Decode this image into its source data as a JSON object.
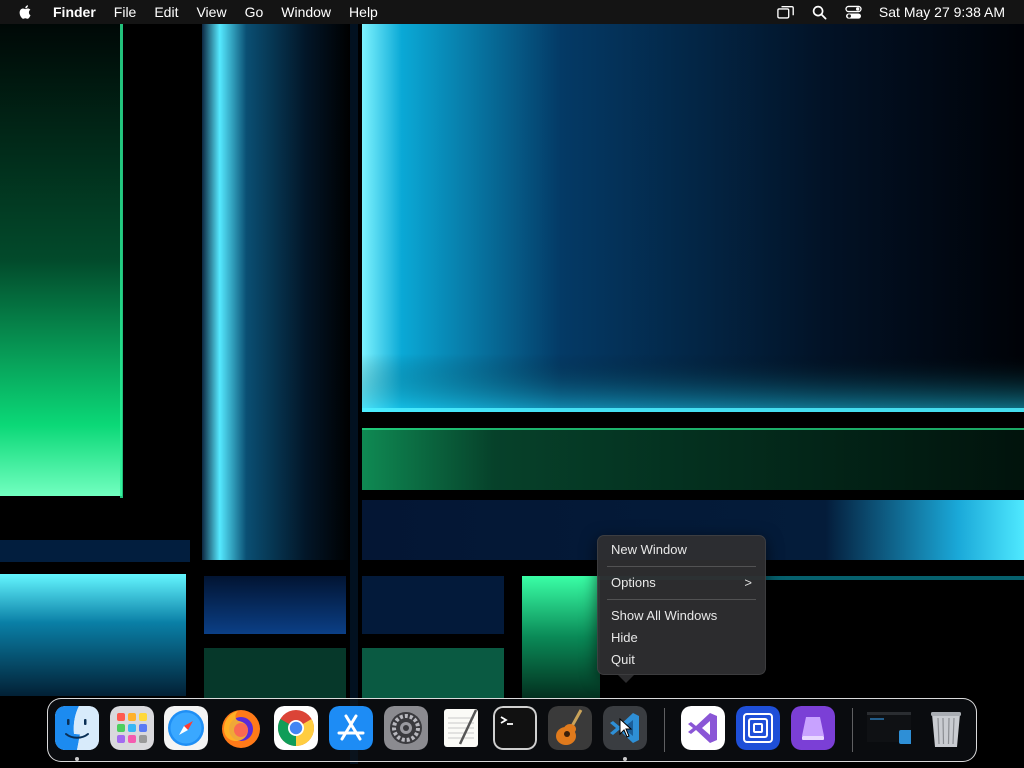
{
  "menubar": {
    "apple_icon": "apple-logo-icon",
    "app_name": "Finder",
    "menus": [
      "File",
      "Edit",
      "View",
      "Go",
      "Window",
      "Help"
    ],
    "status_icons": [
      "screen-mirroring-icon",
      "search-icon",
      "control-center-icon"
    ],
    "clock": "Sat May 27  9:38 AM"
  },
  "context_menu": {
    "items": [
      "New Window",
      "Options",
      "Show All Windows",
      "Hide",
      "Quit"
    ],
    "submenu_arrow": ">"
  },
  "dock": {
    "apps": [
      {
        "name": "Finder",
        "icon": "finder-icon",
        "running": true
      },
      {
        "name": "Launchpad",
        "icon": "launchpad-icon",
        "running": false
      },
      {
        "name": "Safari",
        "icon": "safari-icon",
        "running": false
      },
      {
        "name": "Firefox",
        "icon": "firefox-icon",
        "running": false
      },
      {
        "name": "Google Chrome",
        "icon": "chrome-icon",
        "running": false
      },
      {
        "name": "App Store",
        "icon": "app-store-icon",
        "running": false
      },
      {
        "name": "System Preferences",
        "icon": "system-preferences-icon",
        "running": false
      },
      {
        "name": "TextEdit",
        "icon": "textedit-icon",
        "running": false
      },
      {
        "name": "Terminal",
        "icon": "terminal-icon",
        "running": false
      },
      {
        "name": "GarageBand",
        "icon": "garageband-icon",
        "running": false
      },
      {
        "name": "Visual Studio Code",
        "icon": "vscode-icon",
        "running": true
      },
      {
        "name": "Visual Studio",
        "icon": "visual-studio-icon",
        "running": false
      },
      {
        "name": "Screens",
        "icon": "screens-icon",
        "running": false
      },
      {
        "name": "Apple Configurator",
        "icon": "configurator-icon",
        "running": false
      },
      {
        "name": "Minimized VS Code Window",
        "icon": "minimized-window-icon",
        "running": false
      },
      {
        "name": "Trash",
        "icon": "trash-icon",
        "running": false
      }
    ]
  },
  "colors": {
    "accent_cyan": "#19d6f2",
    "accent_green": "#19e07a",
    "menubar_bg": "#161616",
    "menu_bg": "#2e2e30"
  }
}
